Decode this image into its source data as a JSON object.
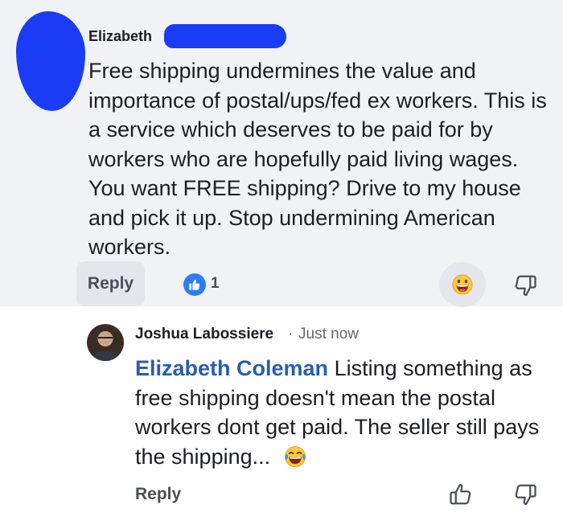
{
  "comments": [
    {
      "author": "Elizabeth",
      "text": "Free shipping undermines the value and importance of postal/ups/fed ex workers. This is a service which deserves to be paid for by workers who are hopefully paid living wages. You want FREE shipping? Drive to my house and pick it up. Stop undermining American workers.",
      "reply_label": "Reply",
      "like_count": "1",
      "reaction_emoji": "grinning-face"
    },
    {
      "author": "Joshua Labossiere",
      "separator": "·",
      "timestamp": "Just now",
      "mention": "Elizabeth Coleman",
      "text": "Listing something as free shipping doesn't mean the postal workers dont get paid. The seller still pays the shipping...",
      "inline_emoji": "laughing-tears-face",
      "reply_label": "Reply"
    }
  ],
  "icons": {
    "like": "thumbs-up-icon",
    "dislike": "thumbs-down-icon"
  },
  "colors": {
    "comment_bg": "#f0f2f5",
    "mention": "#2a5db0",
    "like_badge": "#2d7cf6",
    "redaction": "#1a3cf5"
  }
}
